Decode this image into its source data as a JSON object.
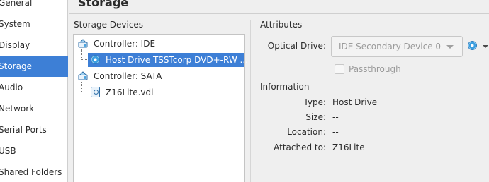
{
  "sidebar": {
    "items": [
      {
        "label": "General"
      },
      {
        "label": "System"
      },
      {
        "label": "Display"
      },
      {
        "label": "Storage"
      },
      {
        "label": "Audio"
      },
      {
        "label": "Network"
      },
      {
        "label": "Serial Ports"
      },
      {
        "label": "USB"
      },
      {
        "label": "Shared Folders"
      }
    ],
    "active": "Storage"
  },
  "header": {
    "title": "Storage"
  },
  "storage_devices": {
    "label": "Storage Devices",
    "tree": [
      {
        "label": "Controller: IDE",
        "icon": "ide-controller-icon"
      },
      {
        "label": "Host Drive TSSTcorp DVD+-RW ...",
        "icon": "optical-disc-icon",
        "selected": true
      },
      {
        "label": "Controller: SATA",
        "icon": "sata-controller-icon"
      },
      {
        "label": "Z16Lite.vdi",
        "icon": "hard-disk-icon"
      }
    ]
  },
  "attributes": {
    "label": "Attributes",
    "optical_drive_label": "Optical Drive:",
    "optical_drive_value": "IDE Secondary Device 0",
    "passthrough_label": "Passthrough",
    "passthrough_checked": false
  },
  "information": {
    "label": "Information",
    "rows": [
      {
        "key": "Type:",
        "value": "Host Drive"
      },
      {
        "key": "Size:",
        "value": "--"
      },
      {
        "key": "Location:",
        "value": "--"
      },
      {
        "key": "Attached to:",
        "value": "Z16Lite"
      }
    ]
  },
  "colors": {
    "accent": "#3d7fd6",
    "disabled_text": "#9a9a9a"
  }
}
